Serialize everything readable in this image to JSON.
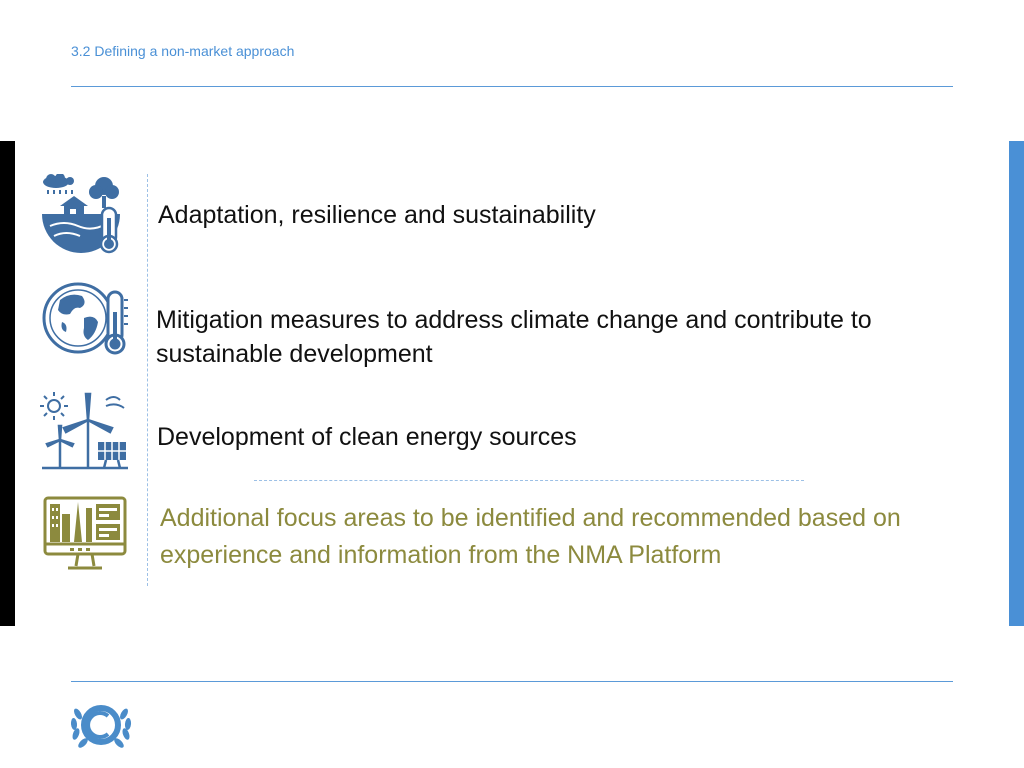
{
  "header": {
    "breadcrumb": "3.2 Defining a non-market approach"
  },
  "items": [
    {
      "icon": "adaptation-landscape-thermometer-icon",
      "text": "Adaptation, resilience and sustainability"
    },
    {
      "icon": "globe-thermometer-icon",
      "text": "Mitigation measures to address climate change and contribute to sustainable development"
    },
    {
      "icon": "clean-energy-wind-solar-icon",
      "text": "Development of clean energy sources"
    },
    {
      "icon": "city-monitor-icon",
      "text": "Additional focus areas to be identified and recommended based on experience and information from the NMA Platform"
    }
  ],
  "colors": {
    "accent_blue": "#4a90d6",
    "icon_blue": "#3f6ea3",
    "olive": "#8c8a3e",
    "black_bar": "#000000"
  },
  "footer": {
    "logo": "unfccc-logo"
  }
}
